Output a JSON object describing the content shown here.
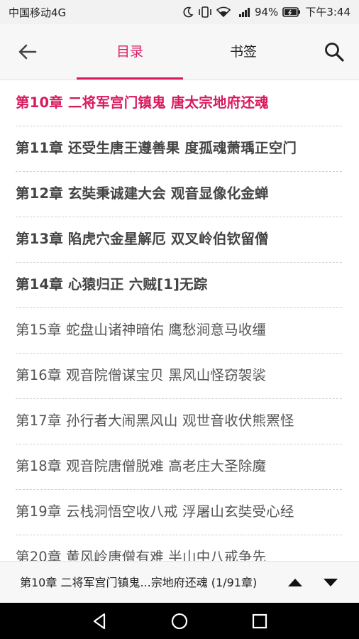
{
  "status_bar": {
    "carrier": "中国移动4G",
    "network_label": "4G",
    "battery": "94%",
    "time": "下午3:44",
    "icons": [
      "moon-icon",
      "vibrate-icon",
      "wifi-icon",
      "signal-icon",
      "battery-icon"
    ]
  },
  "app_bar": {
    "tabs": [
      {
        "label": "目录",
        "active": true
      },
      {
        "label": "书签",
        "active": false
      }
    ],
    "back_icon": "arrow-left-icon",
    "search_icon": "search-icon",
    "accent_color": "#d81b60"
  },
  "chapters": [
    {
      "title": "第10章 二将军宫门镇鬼 唐太宗地府还魂",
      "state": "current"
    },
    {
      "title": "第11章 还受生唐王遵善果 度孤魂萧瑀正空门",
      "state": "bold"
    },
    {
      "title": "第12章 玄奘秉诚建大会 观音显像化金蝉",
      "state": "bold"
    },
    {
      "title": "第13章 陷虎穴金星解厄 双叉岭伯钦留僧",
      "state": "bold"
    },
    {
      "title": "第14章 心猿归正 六贼[1]无踪",
      "state": "bold"
    },
    {
      "title": "第15章 蛇盘山诸神暗佑 鹰愁涧意马收缰",
      "state": "normal"
    },
    {
      "title": "第16章 观音院僧谋宝贝 黑风山怪窃袈裟",
      "state": "normal"
    },
    {
      "title": "第17章 孙行者大闹黑风山 观世音收伏熊罴怪",
      "state": "normal"
    },
    {
      "title": "第18章 观音院唐僧脱难 高老庄大圣除魔",
      "state": "normal"
    },
    {
      "title": "第19章 云栈洞悟空收八戒 浮屠山玄奘受心经",
      "state": "normal"
    },
    {
      "title": "第20章 黄风岭唐僧有难 半山中八戒争先",
      "state": "normal"
    }
  ],
  "bottom_bar": {
    "progress_text": "第10章 二将军宫门镇鬼...宗地府还魂 (1/91章)",
    "up_icon": "triangle-up-icon",
    "down_icon": "triangle-down-icon"
  },
  "nav_bar": {
    "icons": [
      "nav-back-icon",
      "nav-home-icon",
      "nav-recent-icon"
    ]
  }
}
